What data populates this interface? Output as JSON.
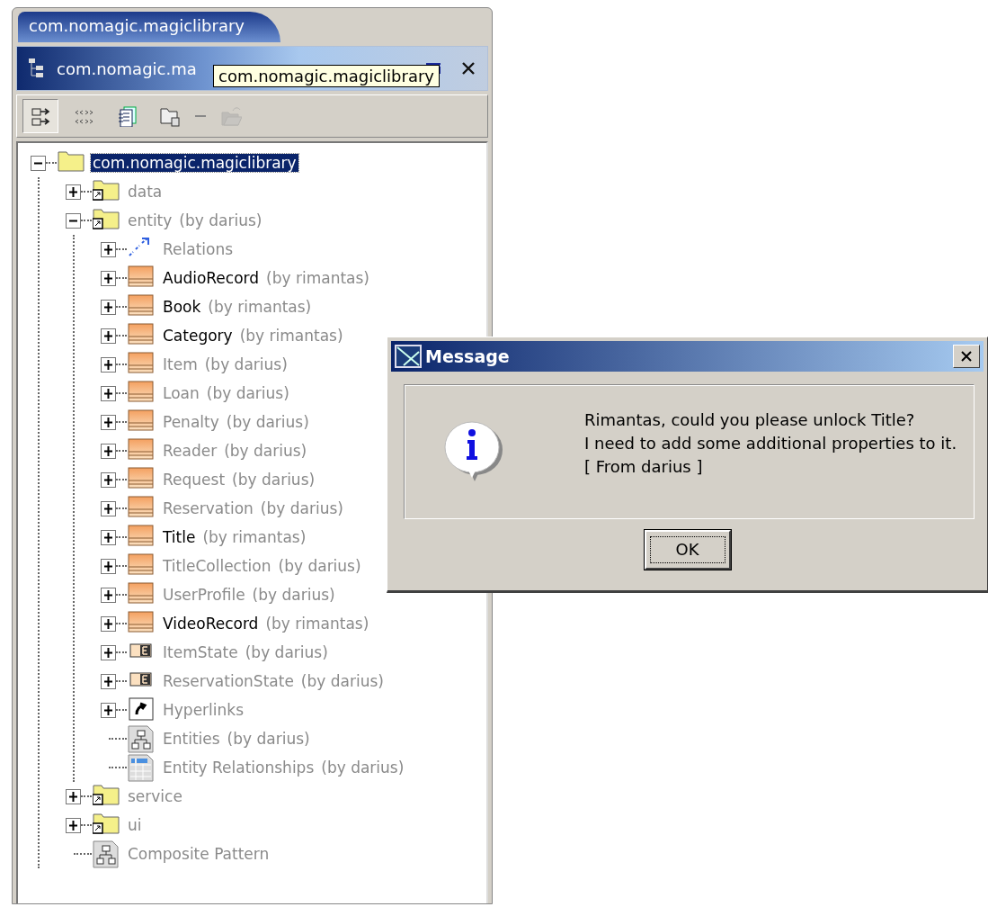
{
  "tabs": [
    {
      "label": "com.nomagic.magiclibrary",
      "selected": true
    }
  ],
  "panel_header": {
    "title": "com.nomagic.ma",
    "tooltip": "com.nomagic.magiclibrary"
  },
  "toolbar": [
    {
      "kind": "expand",
      "selected": true,
      "disabled": false
    },
    {
      "kind": "dots",
      "selected": false,
      "disabled": false
    },
    {
      "kind": "pages",
      "selected": false,
      "disabled": false
    },
    {
      "kind": "folder-lock",
      "selected": false,
      "disabled": false
    },
    {
      "kind": "separator"
    },
    {
      "kind": "open-folder",
      "selected": false,
      "disabled": true
    }
  ],
  "tree": [
    {
      "name": "com.nomagic.magiclibrary",
      "kind": "package",
      "selected": true,
      "expanded": true,
      "children": [
        {
          "name": "data",
          "kind": "shared-package",
          "selected": false,
          "active": false,
          "expanded": false
        },
        {
          "name": "entity",
          "owner": "(by darius)",
          "kind": "shared-package",
          "selected": false,
          "active": false,
          "expanded": true,
          "children": [
            {
              "name": "Relations",
              "kind": "relations",
              "selected": false,
              "active": false,
              "expanded": false
            },
            {
              "name": "AudioRecord",
              "owner": "(by rimantas)",
              "kind": "class",
              "selected": false,
              "active": true,
              "expanded": false
            },
            {
              "name": "Book",
              "owner": "(by rimantas)",
              "kind": "class",
              "selected": false,
              "active": true,
              "expanded": false
            },
            {
              "name": "Category",
              "owner": "(by rimantas)",
              "kind": "class",
              "selected": false,
              "active": true,
              "expanded": false
            },
            {
              "name": "Item",
              "owner": "(by darius)",
              "kind": "class",
              "selected": false,
              "active": false,
              "expanded": false
            },
            {
              "name": "Loan",
              "owner": "(by darius)",
              "kind": "class",
              "selected": false,
              "active": false,
              "expanded": false
            },
            {
              "name": "Penalty",
              "owner": "(by darius)",
              "kind": "class",
              "selected": false,
              "active": false,
              "expanded": false
            },
            {
              "name": "Reader",
              "owner": "(by darius)",
              "kind": "class",
              "selected": false,
              "active": false,
              "expanded": false
            },
            {
              "name": "Request",
              "owner": "(by darius)",
              "kind": "class",
              "selected": false,
              "active": false,
              "expanded": false
            },
            {
              "name": "Reservation",
              "owner": "(by darius)",
              "kind": "class",
              "selected": false,
              "active": false,
              "expanded": false
            },
            {
              "name": "Title",
              "owner": "(by rimantas)",
              "kind": "class",
              "selected": false,
              "active": true,
              "expanded": false
            },
            {
              "name": "TitleCollection",
              "owner": "(by darius)",
              "kind": "class",
              "selected": false,
              "active": false,
              "expanded": false
            },
            {
              "name": "UserProfile",
              "owner": "(by darius)",
              "kind": "class",
              "selected": false,
              "active": false,
              "expanded": false
            },
            {
              "name": "VideoRecord",
              "owner": "(by rimantas)",
              "kind": "class",
              "selected": false,
              "active": true,
              "expanded": false
            },
            {
              "name": "ItemState",
              "owner": "(by darius)",
              "kind": "enumeration",
              "selected": false,
              "active": false,
              "expanded": false
            },
            {
              "name": "ReservationState",
              "owner": "(by darius)",
              "kind": "enumeration",
              "selected": false,
              "active": false,
              "expanded": false
            },
            {
              "name": "Hyperlinks",
              "kind": "hyperlinks",
              "selected": false,
              "active": false,
              "expanded": false
            },
            {
              "name": "Entities",
              "owner": "(by darius)",
              "kind": "diagram",
              "selected": false,
              "active": false
            },
            {
              "name": "Entity Relationships",
              "owner": "(by darius)",
              "kind": "table",
              "selected": false,
              "active": false
            }
          ]
        },
        {
          "name": "service",
          "kind": "shared-package",
          "selected": false,
          "active": false,
          "expanded": false
        },
        {
          "name": "ui",
          "kind": "shared-package",
          "selected": false,
          "active": false,
          "expanded": false
        },
        {
          "name": "Composite Pattern",
          "kind": "diagram",
          "selected": false,
          "active": false
        }
      ]
    }
  ],
  "dialog": {
    "title": "Message",
    "lines": [
      "Rimantas, could you please unlock Title?",
      "I need to add some additional properties to it.",
      "[ From darius ]"
    ],
    "button": "OK"
  }
}
